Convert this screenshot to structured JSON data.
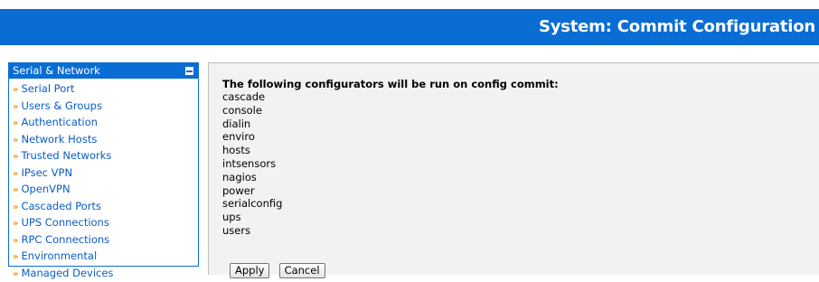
{
  "header": {
    "title": "System: Commit Configuration"
  },
  "sidebar": {
    "title": "Serial & Network",
    "items": [
      {
        "label": "Serial Port"
      },
      {
        "label": "Users & Groups"
      },
      {
        "label": "Authentication"
      },
      {
        "label": "Network Hosts"
      },
      {
        "label": "Trusted Networks"
      },
      {
        "label": "IPsec VPN"
      },
      {
        "label": "OpenVPN"
      },
      {
        "label": "Cascaded Ports"
      },
      {
        "label": "UPS Connections"
      },
      {
        "label": "RPC Connections"
      },
      {
        "label": "Environmental"
      },
      {
        "label": "Managed Devices"
      }
    ]
  },
  "main": {
    "heading": "The following configurators will be run on config commit:",
    "configurators": [
      "cascade",
      "console",
      "dialin",
      "enviro",
      "hosts",
      "intsensors",
      "nagios",
      "power",
      "serialconfig",
      "ups",
      "users"
    ],
    "apply_label": "Apply",
    "cancel_label": "Cancel"
  },
  "colors": {
    "accent": "#0A6DD4",
    "link": "#0A5CC4",
    "bullet": "#E8961C",
    "panel_bg": "#f2f2f2"
  },
  "icons": {
    "collapse": "minus-square-icon",
    "bullet": "double-chevron-right-icon"
  }
}
